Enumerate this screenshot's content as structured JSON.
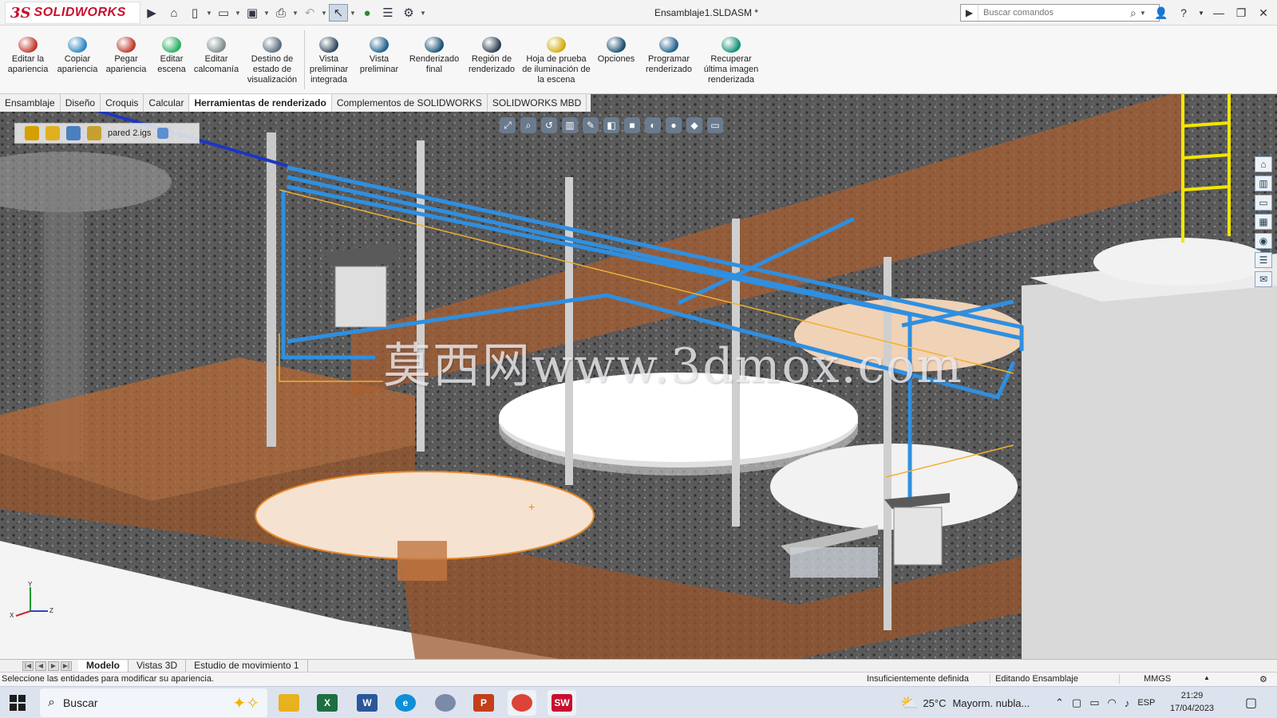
{
  "app": {
    "logo_ds": "3S",
    "logo_name": "SOLIDWORKS",
    "document_title": "Ensamblaje1.SLDASM *",
    "search_placeholder": "Buscar comandos"
  },
  "ribbon": [
    {
      "label": "Editar la apariencia",
      "icon": "edit-appearance-icon",
      "color": "#c0392b"
    },
    {
      "label": "Copiar apariencia",
      "icon": "copy-appearance-icon",
      "color": "#2e86c1"
    },
    {
      "label": "Pegar apariencia",
      "icon": "paste-appearance-icon",
      "color": "#c0392b"
    },
    {
      "label": "Editar escena",
      "icon": "edit-scene-icon",
      "color": "#27ae60"
    },
    {
      "label": "Editar calcomanía",
      "icon": "edit-decal-icon",
      "color": "#7f8c8d"
    },
    {
      "label": "Destino de estado de visualización",
      "icon": "display-state-target-icon",
      "color": "#5d6d7e"
    },
    {
      "label": "Vista preliminar integrada",
      "icon": "integrated-preview-icon",
      "color": "#34495e"
    },
    {
      "label": "Vista preliminar",
      "icon": "preview-window-icon",
      "color": "#1f618d"
    },
    {
      "label": "Renderizado final",
      "icon": "final-render-icon",
      "color": "#1a5276"
    },
    {
      "label": "Región de renderizado",
      "icon": "render-region-icon",
      "color": "#2c3e50"
    },
    {
      "label": "Hoja de prueba de iluminación de la escena",
      "icon": "scene-illumination-proof-icon",
      "color": "#d4ac0d"
    },
    {
      "label": "Opciones",
      "icon": "options-icon",
      "color": "#1b4f72"
    },
    {
      "label": "Programar renderizado",
      "icon": "schedule-render-icon",
      "color": "#21618c"
    },
    {
      "label": "Recuperar última imagen renderizada",
      "icon": "recover-last-render-icon",
      "color": "#148f77"
    }
  ],
  "command_tabs": [
    {
      "label": "Ensamblaje",
      "active": false
    },
    {
      "label": "Diseño",
      "active": false
    },
    {
      "label": "Croquis",
      "active": false
    },
    {
      "label": "Calcular",
      "active": false
    },
    {
      "label": "Herramientas de renderizado",
      "active": true
    },
    {
      "label": "Complementos de SOLIDWORKS",
      "active": false
    },
    {
      "label": "SOLIDWORKS MBD",
      "active": false
    }
  ],
  "breadcrumb": {
    "part_label": "pared 2.igs",
    "icons": [
      "assembly-icon",
      "subassembly-icon",
      "part-icon",
      "component-icon",
      "face-icon"
    ]
  },
  "watermark": "莫西网www.3dmox.com",
  "triad": {
    "x": "X",
    "y": "Y",
    "z": "Z"
  },
  "bottom_tabs": [
    {
      "label": "Modelo",
      "active": true
    },
    {
      "label": "Vistas 3D",
      "active": false
    },
    {
      "label": "Estudio de movimiento 1",
      "active": false
    }
  ],
  "status": {
    "message": "Seleccione las entidades para modificar su apariencia.",
    "definition": "Insuficientemente definida",
    "mode": "Editando Ensamblaje",
    "units": "MMGS"
  },
  "taskbar": {
    "search_label": "Buscar",
    "temperature": "25°C",
    "weather": "Mayorm. nubla...",
    "language": "ESP",
    "time": "21:29",
    "date": "17/04/2023",
    "apps": [
      {
        "name": "file-explorer",
        "label": "",
        "color": "#e8b21e"
      },
      {
        "name": "excel",
        "label": "X",
        "color": "#1d6f42"
      },
      {
        "name": "word",
        "label": "W",
        "color": "#2b579a"
      },
      {
        "name": "edge",
        "label": "e",
        "color": "#0f8fd6"
      },
      {
        "name": "network-app",
        "label": "",
        "color": "#7a8aa8"
      },
      {
        "name": "powerpoint",
        "label": "P",
        "color": "#c43e1c"
      },
      {
        "name": "chrome",
        "label": "",
        "color": "#db4437"
      },
      {
        "name": "solidworks",
        "label": "SW",
        "color": "#c8102e"
      }
    ]
  }
}
